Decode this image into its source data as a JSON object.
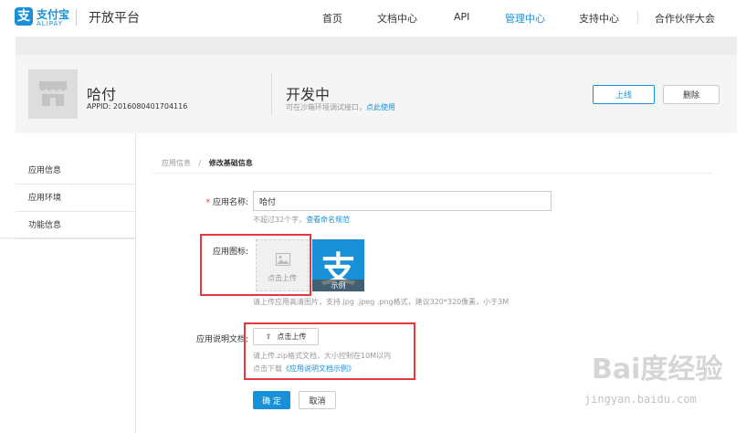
{
  "header": {
    "brand_cn": "支付宝",
    "brand_en": "ALIPAY",
    "platform": "开放平台",
    "nav": [
      "首页",
      "文档中心",
      "API",
      "管理中心",
      "支持中心",
      "合作伙伴大会"
    ],
    "active_nav": "管理中心",
    "accent": "#1890d8"
  },
  "app": {
    "name": "哈付",
    "appid": "APPID: 2016080401704116",
    "status": "开发中",
    "status_hint": "可在沙箱环境调试接口，",
    "status_link": "点此使用",
    "online_label": "上线",
    "delete_label": "删除"
  },
  "sidebar": {
    "items": [
      "应用信息",
      "应用环境",
      "功能信息"
    ]
  },
  "breadcrumb": {
    "parent": "应用信息",
    "sep": "/",
    "current": "修改基础信息"
  },
  "form": {
    "name_required_mark": "*",
    "name_label": "应用名称:",
    "name_value": "哈付",
    "name_help": "不超过32个字，",
    "name_help_link": "查看命名规范",
    "icon_label": "应用图标:",
    "icon_upload_text": "点击上传",
    "icon_sample_char": "支",
    "icon_sample_caption": "示例",
    "icon_help": "请上传应用高清图片，支持.jpg .jpeg .png格式，建议320*320像素，小于3M",
    "doc_label": "应用说明文档:",
    "doc_upload_label": "点击上传",
    "doc_help_line1": "请上传.zip格式文档，大小控制在10M以内",
    "doc_help_line2": "点击下载",
    "doc_help_link": "《应用说明文档示例》",
    "ok_label": "确 定",
    "cancel_label": "取消"
  },
  "watermark": {
    "logo": "Bai度经验",
    "url": "jingyan.baidu.com"
  },
  "colors": {
    "highlight_red": "#e4393c",
    "primary_blue": "#1890d8"
  }
}
